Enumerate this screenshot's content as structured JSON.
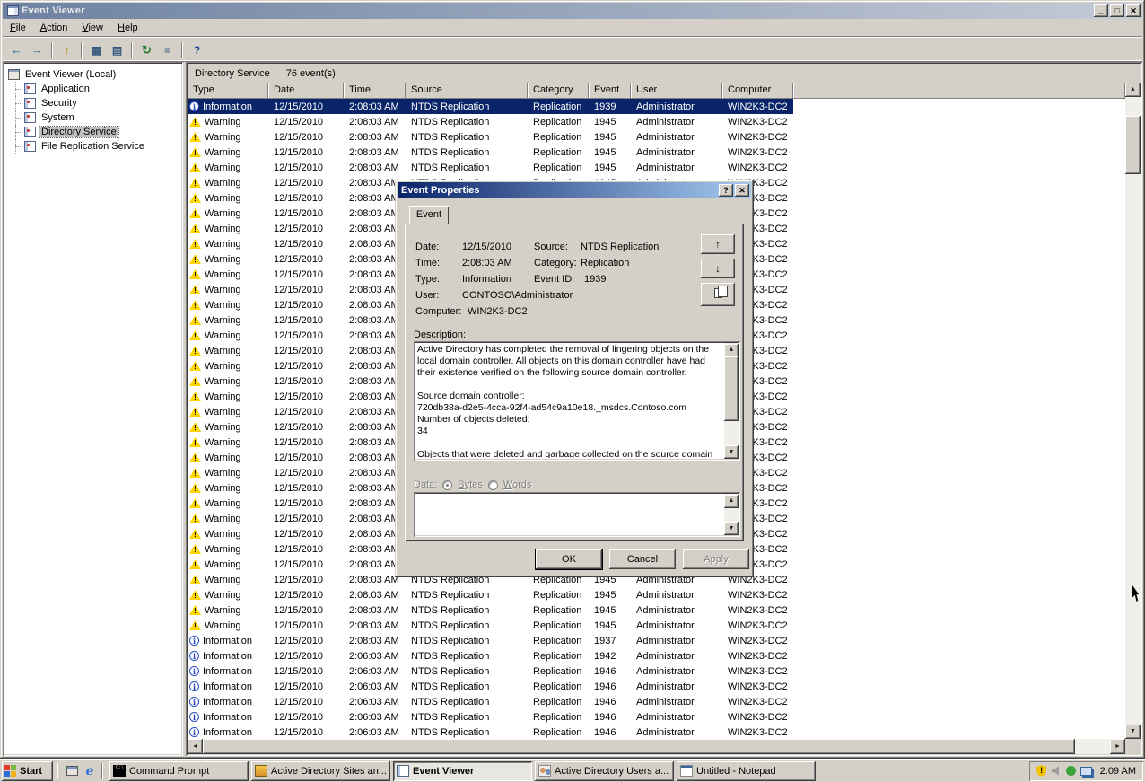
{
  "icons": {
    "minimize": "_",
    "maximize": "□",
    "close": "✕",
    "help": "?",
    "up": "▲",
    "down": "▼",
    "left": "◄",
    "right": "►",
    "arrow_up": "↑",
    "arrow_down": "↓",
    "ie": "e",
    "cmd": "C:\\"
  },
  "window": {
    "title": "Event Viewer",
    "menu": [
      "File",
      "Action",
      "View",
      "Help"
    ]
  },
  "toolbar": {
    "items": [
      {
        "type": "button",
        "name": "back",
        "glyph": "←"
      },
      {
        "type": "button",
        "name": "forward",
        "glyph": "→"
      },
      {
        "type": "sep"
      },
      {
        "type": "button",
        "name": "up-one-level",
        "glyph": "↑"
      },
      {
        "type": "sep"
      },
      {
        "type": "button",
        "name": "show-console-tree",
        "glyph": "▦"
      },
      {
        "type": "button",
        "name": "properties",
        "glyph": "▤"
      },
      {
        "type": "sep"
      },
      {
        "type": "button",
        "name": "refresh",
        "glyph": "↻"
      },
      {
        "type": "button",
        "name": "export-list",
        "glyph": "≡"
      },
      {
        "type": "sep"
      },
      {
        "type": "button",
        "name": "help",
        "glyph": "?"
      }
    ]
  },
  "tree": {
    "root": "Event Viewer (Local)",
    "items": [
      {
        "label": "Application",
        "selected": false
      },
      {
        "label": "Security",
        "selected": false
      },
      {
        "label": "System",
        "selected": false
      },
      {
        "label": "Directory Service",
        "selected": true
      },
      {
        "label": "File Replication Service",
        "selected": false
      }
    ]
  },
  "result_header": {
    "title": "Directory Service",
    "count": "76 event(s)"
  },
  "table": {
    "columns": [
      "Type",
      "Date",
      "Time",
      "Source",
      "Category",
      "Event",
      "User",
      "Computer"
    ],
    "selected_index": 0,
    "rows": [
      [
        "Information",
        "12/15/2010",
        "2:08:03 AM",
        "NTDS Replication",
        "Replication",
        "1939",
        "Administrator",
        "WIN2K3-DC2"
      ],
      [
        "Warning",
        "12/15/2010",
        "2:08:03 AM",
        "NTDS Replication",
        "Replication",
        "1945",
        "Administrator",
        "WIN2K3-DC2"
      ],
      [
        "Warning",
        "12/15/2010",
        "2:08:03 AM",
        "NTDS Replication",
        "Replication",
        "1945",
        "Administrator",
        "WIN2K3-DC2"
      ],
      [
        "Warning",
        "12/15/2010",
        "2:08:03 AM",
        "NTDS Replication",
        "Replication",
        "1945",
        "Administrator",
        "WIN2K3-DC2"
      ],
      [
        "Warning",
        "12/15/2010",
        "2:08:03 AM",
        "NTDS Replication",
        "Replication",
        "1945",
        "Administrator",
        "WIN2K3-DC2"
      ],
      [
        "Warning",
        "12/15/2010",
        "2:08:03 AM",
        "NTDS Replication",
        "Replication",
        "1945",
        "Administrator",
        "WIN2K3-DC2"
      ],
      [
        "Warning",
        "12/15/2010",
        "2:08:03 AM",
        "NTDS Replication",
        "Replication",
        "1945",
        "Administrator",
        "WIN2K3-DC2"
      ],
      [
        "Warning",
        "12/15/2010",
        "2:08:03 AM",
        "NTDS Replication",
        "Replication",
        "1945",
        "Administrator",
        "WIN2K3-DC2"
      ],
      [
        "Warning",
        "12/15/2010",
        "2:08:03 AM",
        "NTDS Replication",
        "Replication",
        "1945",
        "Administrator",
        "WIN2K3-DC2"
      ],
      [
        "Warning",
        "12/15/2010",
        "2:08:03 AM",
        "NTDS Replication",
        "Replication",
        "1945",
        "Administrator",
        "WIN2K3-DC2"
      ],
      [
        "Warning",
        "12/15/2010",
        "2:08:03 AM",
        "NTDS Replication",
        "Replication",
        "1945",
        "Administrator",
        "WIN2K3-DC2"
      ],
      [
        "Warning",
        "12/15/2010",
        "2:08:03 AM",
        "NTDS Replication",
        "Replication",
        "1945",
        "Administrator",
        "WIN2K3-DC2"
      ],
      [
        "Warning",
        "12/15/2010",
        "2:08:03 AM",
        "NTDS Replication",
        "Replication",
        "1945",
        "Administrator",
        "WIN2K3-DC2"
      ],
      [
        "Warning",
        "12/15/2010",
        "2:08:03 AM",
        "NTDS Replication",
        "Replication",
        "1945",
        "Administrator",
        "WIN2K3-DC2"
      ],
      [
        "Warning",
        "12/15/2010",
        "2:08:03 AM",
        "NTDS Replication",
        "Replication",
        "1945",
        "Administrator",
        "WIN2K3-DC2"
      ],
      [
        "Warning",
        "12/15/2010",
        "2:08:03 AM",
        "NTDS Replication",
        "Replication",
        "1945",
        "Administrator",
        "WIN2K3-DC2"
      ],
      [
        "Warning",
        "12/15/2010",
        "2:08:03 AM",
        "NTDS Replication",
        "Replication",
        "1945",
        "Administrator",
        "WIN2K3-DC2"
      ],
      [
        "Warning",
        "12/15/2010",
        "2:08:03 AM",
        "NTDS Replication",
        "Replication",
        "1945",
        "Administrator",
        "WIN2K3-DC2"
      ],
      [
        "Warning",
        "12/15/2010",
        "2:08:03 AM",
        "NTDS Replication",
        "Replication",
        "1945",
        "Administrator",
        "WIN2K3-DC2"
      ],
      [
        "Warning",
        "12/15/2010",
        "2:08:03 AM",
        "NTDS Replication",
        "Replication",
        "1945",
        "Administrator",
        "WIN2K3-DC2"
      ],
      [
        "Warning",
        "12/15/2010",
        "2:08:03 AM",
        "NTDS Replication",
        "Replication",
        "1945",
        "Administrator",
        "WIN2K3-DC2"
      ],
      [
        "Warning",
        "12/15/2010",
        "2:08:03 AM",
        "NTDS Replication",
        "Replication",
        "1945",
        "Administrator",
        "WIN2K3-DC2"
      ],
      [
        "Warning",
        "12/15/2010",
        "2:08:03 AM",
        "NTDS Replication",
        "Replication",
        "1945",
        "Administrator",
        "WIN2K3-DC2"
      ],
      [
        "Warning",
        "12/15/2010",
        "2:08:03 AM",
        "NTDS Replication",
        "Replication",
        "1945",
        "Administrator",
        "WIN2K3-DC2"
      ],
      [
        "Warning",
        "12/15/2010",
        "2:08:03 AM",
        "NTDS Replication",
        "Replication",
        "1945",
        "Administrator",
        "WIN2K3-DC2"
      ],
      [
        "Warning",
        "12/15/2010",
        "2:08:03 AM",
        "NTDS Replication",
        "Replication",
        "1945",
        "Administrator",
        "WIN2K3-DC2"
      ],
      [
        "Warning",
        "12/15/2010",
        "2:08:03 AM",
        "NTDS Replication",
        "Replication",
        "1945",
        "Administrator",
        "WIN2K3-DC2"
      ],
      [
        "Warning",
        "12/15/2010",
        "2:08:03 AM",
        "NTDS Replication",
        "Replication",
        "1945",
        "Administrator",
        "WIN2K3-DC2"
      ],
      [
        "Warning",
        "12/15/2010",
        "2:08:03 AM",
        "NTDS Replication",
        "Replication",
        "1945",
        "Administrator",
        "WIN2K3-DC2"
      ],
      [
        "Warning",
        "12/15/2010",
        "2:08:03 AM",
        "NTDS Replication",
        "Replication",
        "1945",
        "Administrator",
        "WIN2K3-DC2"
      ],
      [
        "Warning",
        "12/15/2010",
        "2:08:03 AM",
        "NTDS Replication",
        "Replication",
        "1945",
        "Administrator",
        "WIN2K3-DC2"
      ],
      [
        "Warning",
        "12/15/2010",
        "2:08:03 AM",
        "NTDS Replication",
        "Replication",
        "1945",
        "Administrator",
        "WIN2K3-DC2"
      ],
      [
        "Warning",
        "12/15/2010",
        "2:08:03 AM",
        "NTDS Replication",
        "Replication",
        "1945",
        "Administrator",
        "WIN2K3-DC2"
      ],
      [
        "Warning",
        "12/15/2010",
        "2:08:03 AM",
        "NTDS Replication",
        "Replication",
        "1945",
        "Administrator",
        "WIN2K3-DC2"
      ],
      [
        "Warning",
        "12/15/2010",
        "2:08:03 AM",
        "NTDS Replication",
        "Replication",
        "1945",
        "Administrator",
        "WIN2K3-DC2"
      ],
      [
        "Information",
        "12/15/2010",
        "2:08:03 AM",
        "NTDS Replication",
        "Replication",
        "1937",
        "Administrator",
        "WIN2K3-DC2"
      ],
      [
        "Information",
        "12/15/2010",
        "2:06:03 AM",
        "NTDS Replication",
        "Replication",
        "1942",
        "Administrator",
        "WIN2K3-DC2"
      ],
      [
        "Information",
        "12/15/2010",
        "2:06:03 AM",
        "NTDS Replication",
        "Replication",
        "1946",
        "Administrator",
        "WIN2K3-DC2"
      ],
      [
        "Information",
        "12/15/2010",
        "2:06:03 AM",
        "NTDS Replication",
        "Replication",
        "1946",
        "Administrator",
        "WIN2K3-DC2"
      ],
      [
        "Information",
        "12/15/2010",
        "2:06:03 AM",
        "NTDS Replication",
        "Replication",
        "1946",
        "Administrator",
        "WIN2K3-DC2"
      ],
      [
        "Information",
        "12/15/2010",
        "2:06:03 AM",
        "NTDS Replication",
        "Replication",
        "1946",
        "Administrator",
        "WIN2K3-DC2"
      ],
      [
        "Information",
        "12/15/2010",
        "2:06:03 AM",
        "NTDS Replication",
        "Replication",
        "1946",
        "Administrator",
        "WIN2K3-DC2"
      ]
    ]
  },
  "dialog": {
    "title": "Event Properties",
    "tab": "Event",
    "fields": {
      "date_label": "Date:",
      "date": "12/15/2010",
      "source_label": "Source:",
      "source": "NTDS Replication",
      "time_label": "Time:",
      "time": "2:08:03 AM",
      "category_label": "Category:",
      "category": "Replication",
      "type_label": "Type:",
      "type": "Information",
      "event_id_label": "Event ID:",
      "event_id": "1939",
      "user_label": "User:",
      "user": "CONTOSO\\Administrator",
      "computer_label": "Computer:",
      "computer": "WIN2K3-DC2"
    },
    "description_label": "Description:",
    "description": "Active Directory has completed the removal of lingering objects on the local domain controller. All objects on this domain controller have had their existence verified on the following source domain controller.\n\nSource domain controller:\n720db38a-d2e5-4cca-92f4-ad54c9a10e18._msdcs.Contoso.com\nNumber of objects deleted:\n34\n\nObjects that were deleted and garbage collected on the source domain",
    "data_label": "Data:",
    "bytes_label": "Bytes",
    "words_label": "Words",
    "buttons": {
      "ok": "OK",
      "cancel": "Cancel",
      "apply": "Apply"
    }
  },
  "taskbar": {
    "start_label": "Start",
    "tasks": [
      {
        "label": "Command Prompt",
        "icon": "cmd",
        "active": false
      },
      {
        "label": "Active Directory Sites an...",
        "icon": "sites",
        "active": false
      },
      {
        "label": "Event Viewer",
        "icon": "eventvwr",
        "active": true
      },
      {
        "label": "Active Directory Users a...",
        "icon": "users",
        "active": false
      },
      {
        "label": "Untitled - Notepad",
        "icon": "notepad",
        "active": false
      }
    ],
    "clock": "2:09 AM"
  }
}
